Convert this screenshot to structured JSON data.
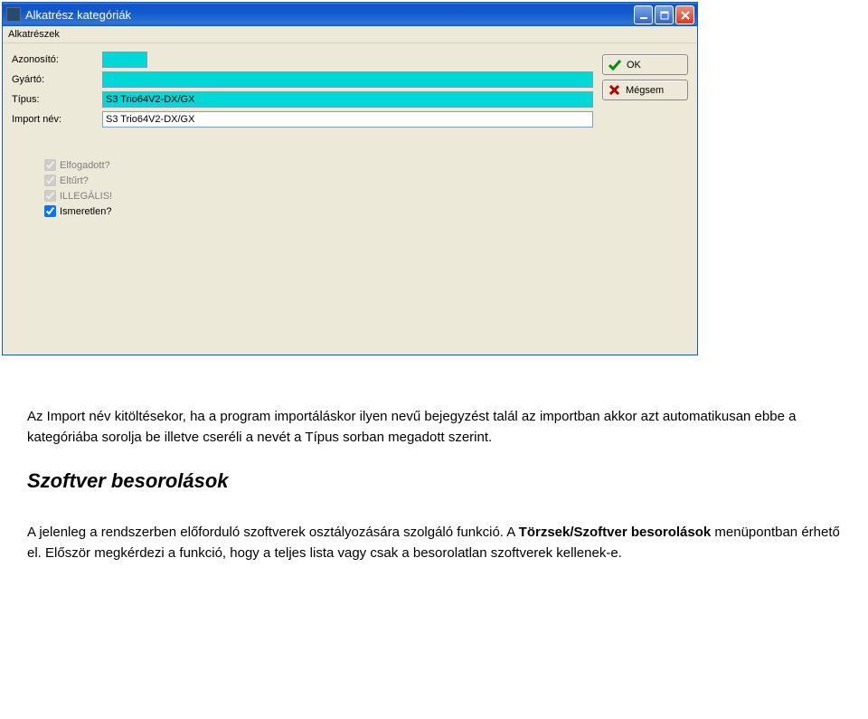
{
  "window": {
    "title": "Alkatrész kategóriák"
  },
  "menubar": {
    "item1": "Alkatrészek"
  },
  "form": {
    "id_label": "Azonosító:",
    "id_value": "",
    "maker_label": "Gyártó:",
    "maker_value": "",
    "type_label": "Típus:",
    "type_value": "S3 Trio64V2-DX/GX",
    "import_label": "Import név:",
    "import_value": "S3 Trio64V2-DX/GX"
  },
  "buttons": {
    "ok": "OK",
    "cancel": "Mégsem"
  },
  "checks": {
    "accepted": "Elfogadott?",
    "tolerated": "Eltűrt?",
    "illegal": "ILLEGÁLIS!",
    "unknown": "Ismeretlen?"
  },
  "body_text": {
    "p1": "Az Import név kitöltésekor, ha a program importáláskor ilyen nevű bejegyzést talál az importban akkor azt automatikusan ebbe a kategóriába sorolja be illetve cseréli a nevét a Típus sorban megadott szerint.",
    "h2": "Szoftver besorolások",
    "p2a": "A jelenleg a rendszerben előforduló szoftverek osztályozására szolgáló funkció. A ",
    "p2b": "Törzsek/Szoftver besorolások",
    "p2c": " menüpontban érhető el. Először megkérdezi a funkció, hogy a teljes lista vagy csak a besorolatlan szoftverek kellenek-e."
  }
}
